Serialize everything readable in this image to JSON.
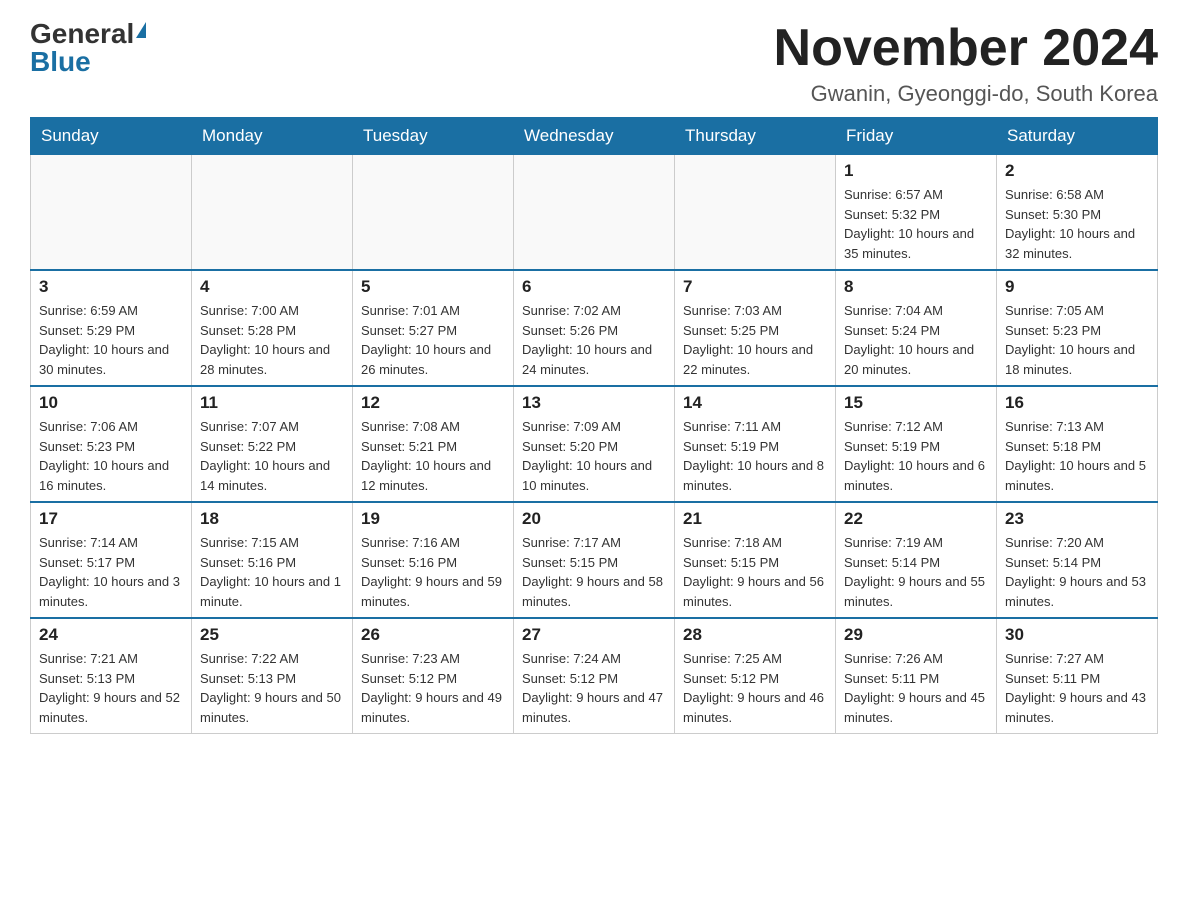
{
  "header": {
    "logo_general": "General",
    "logo_blue": "Blue",
    "month_title": "November 2024",
    "location": "Gwanin, Gyeonggi-do, South Korea"
  },
  "weekdays": [
    "Sunday",
    "Monday",
    "Tuesday",
    "Wednesday",
    "Thursday",
    "Friday",
    "Saturday"
  ],
  "weeks": [
    [
      {
        "day": "",
        "sunrise": "",
        "sunset": "",
        "daylight": ""
      },
      {
        "day": "",
        "sunrise": "",
        "sunset": "",
        "daylight": ""
      },
      {
        "day": "",
        "sunrise": "",
        "sunset": "",
        "daylight": ""
      },
      {
        "day": "",
        "sunrise": "",
        "sunset": "",
        "daylight": ""
      },
      {
        "day": "",
        "sunrise": "",
        "sunset": "",
        "daylight": ""
      },
      {
        "day": "1",
        "sunrise": "Sunrise: 6:57 AM",
        "sunset": "Sunset: 5:32 PM",
        "daylight": "Daylight: 10 hours and 35 minutes."
      },
      {
        "day": "2",
        "sunrise": "Sunrise: 6:58 AM",
        "sunset": "Sunset: 5:30 PM",
        "daylight": "Daylight: 10 hours and 32 minutes."
      }
    ],
    [
      {
        "day": "3",
        "sunrise": "Sunrise: 6:59 AM",
        "sunset": "Sunset: 5:29 PM",
        "daylight": "Daylight: 10 hours and 30 minutes."
      },
      {
        "day": "4",
        "sunrise": "Sunrise: 7:00 AM",
        "sunset": "Sunset: 5:28 PM",
        "daylight": "Daylight: 10 hours and 28 minutes."
      },
      {
        "day": "5",
        "sunrise": "Sunrise: 7:01 AM",
        "sunset": "Sunset: 5:27 PM",
        "daylight": "Daylight: 10 hours and 26 minutes."
      },
      {
        "day": "6",
        "sunrise": "Sunrise: 7:02 AM",
        "sunset": "Sunset: 5:26 PM",
        "daylight": "Daylight: 10 hours and 24 minutes."
      },
      {
        "day": "7",
        "sunrise": "Sunrise: 7:03 AM",
        "sunset": "Sunset: 5:25 PM",
        "daylight": "Daylight: 10 hours and 22 minutes."
      },
      {
        "day": "8",
        "sunrise": "Sunrise: 7:04 AM",
        "sunset": "Sunset: 5:24 PM",
        "daylight": "Daylight: 10 hours and 20 minutes."
      },
      {
        "day": "9",
        "sunrise": "Sunrise: 7:05 AM",
        "sunset": "Sunset: 5:23 PM",
        "daylight": "Daylight: 10 hours and 18 minutes."
      }
    ],
    [
      {
        "day": "10",
        "sunrise": "Sunrise: 7:06 AM",
        "sunset": "Sunset: 5:23 PM",
        "daylight": "Daylight: 10 hours and 16 minutes."
      },
      {
        "day": "11",
        "sunrise": "Sunrise: 7:07 AM",
        "sunset": "Sunset: 5:22 PM",
        "daylight": "Daylight: 10 hours and 14 minutes."
      },
      {
        "day": "12",
        "sunrise": "Sunrise: 7:08 AM",
        "sunset": "Sunset: 5:21 PM",
        "daylight": "Daylight: 10 hours and 12 minutes."
      },
      {
        "day": "13",
        "sunrise": "Sunrise: 7:09 AM",
        "sunset": "Sunset: 5:20 PM",
        "daylight": "Daylight: 10 hours and 10 minutes."
      },
      {
        "day": "14",
        "sunrise": "Sunrise: 7:11 AM",
        "sunset": "Sunset: 5:19 PM",
        "daylight": "Daylight: 10 hours and 8 minutes."
      },
      {
        "day": "15",
        "sunrise": "Sunrise: 7:12 AM",
        "sunset": "Sunset: 5:19 PM",
        "daylight": "Daylight: 10 hours and 6 minutes."
      },
      {
        "day": "16",
        "sunrise": "Sunrise: 7:13 AM",
        "sunset": "Sunset: 5:18 PM",
        "daylight": "Daylight: 10 hours and 5 minutes."
      }
    ],
    [
      {
        "day": "17",
        "sunrise": "Sunrise: 7:14 AM",
        "sunset": "Sunset: 5:17 PM",
        "daylight": "Daylight: 10 hours and 3 minutes."
      },
      {
        "day": "18",
        "sunrise": "Sunrise: 7:15 AM",
        "sunset": "Sunset: 5:16 PM",
        "daylight": "Daylight: 10 hours and 1 minute."
      },
      {
        "day": "19",
        "sunrise": "Sunrise: 7:16 AM",
        "sunset": "Sunset: 5:16 PM",
        "daylight": "Daylight: 9 hours and 59 minutes."
      },
      {
        "day": "20",
        "sunrise": "Sunrise: 7:17 AM",
        "sunset": "Sunset: 5:15 PM",
        "daylight": "Daylight: 9 hours and 58 minutes."
      },
      {
        "day": "21",
        "sunrise": "Sunrise: 7:18 AM",
        "sunset": "Sunset: 5:15 PM",
        "daylight": "Daylight: 9 hours and 56 minutes."
      },
      {
        "day": "22",
        "sunrise": "Sunrise: 7:19 AM",
        "sunset": "Sunset: 5:14 PM",
        "daylight": "Daylight: 9 hours and 55 minutes."
      },
      {
        "day": "23",
        "sunrise": "Sunrise: 7:20 AM",
        "sunset": "Sunset: 5:14 PM",
        "daylight": "Daylight: 9 hours and 53 minutes."
      }
    ],
    [
      {
        "day": "24",
        "sunrise": "Sunrise: 7:21 AM",
        "sunset": "Sunset: 5:13 PM",
        "daylight": "Daylight: 9 hours and 52 minutes."
      },
      {
        "day": "25",
        "sunrise": "Sunrise: 7:22 AM",
        "sunset": "Sunset: 5:13 PM",
        "daylight": "Daylight: 9 hours and 50 minutes."
      },
      {
        "day": "26",
        "sunrise": "Sunrise: 7:23 AM",
        "sunset": "Sunset: 5:12 PM",
        "daylight": "Daylight: 9 hours and 49 minutes."
      },
      {
        "day": "27",
        "sunrise": "Sunrise: 7:24 AM",
        "sunset": "Sunset: 5:12 PM",
        "daylight": "Daylight: 9 hours and 47 minutes."
      },
      {
        "day": "28",
        "sunrise": "Sunrise: 7:25 AM",
        "sunset": "Sunset: 5:12 PM",
        "daylight": "Daylight: 9 hours and 46 minutes."
      },
      {
        "day": "29",
        "sunrise": "Sunrise: 7:26 AM",
        "sunset": "Sunset: 5:11 PM",
        "daylight": "Daylight: 9 hours and 45 minutes."
      },
      {
        "day": "30",
        "sunrise": "Sunrise: 7:27 AM",
        "sunset": "Sunset: 5:11 PM",
        "daylight": "Daylight: 9 hours and 43 minutes."
      }
    ]
  ]
}
